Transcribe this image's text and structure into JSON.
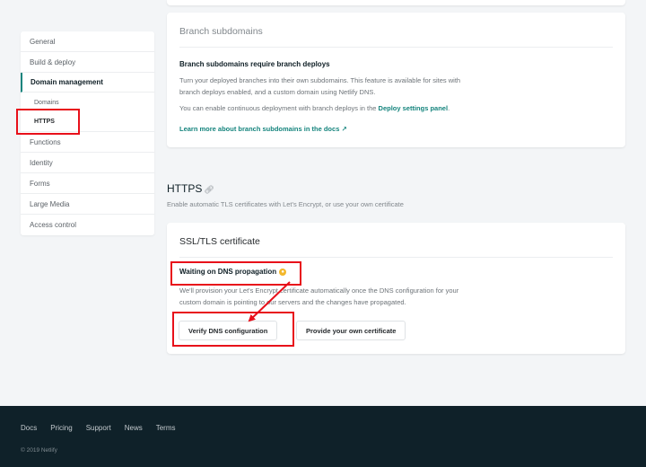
{
  "sidebar": {
    "items": [
      {
        "label": "General"
      },
      {
        "label": "Build & deploy"
      },
      {
        "label": "Domain management"
      },
      {
        "label": "Domains"
      },
      {
        "label": "HTTPS"
      },
      {
        "label": "Functions"
      },
      {
        "label": "Identity"
      },
      {
        "label": "Forms"
      },
      {
        "label": "Large Media"
      },
      {
        "label": "Access control"
      }
    ]
  },
  "branch_card": {
    "title": "Branch subdomains",
    "subtitle": "Branch subdomains require branch deploys",
    "line1": "Turn your deployed branches into their own subdomains. This feature is available for sites with",
    "line2": "branch deploys enabled, and a custom domain using Netlify DNS.",
    "line3_prefix": "You can enable continuous deployment with branch deploys in the ",
    "line3_link": "Deploy settings panel",
    "line3_suffix": ".",
    "learn_link": "Learn more about branch subdomains in the docs ↗"
  },
  "https_section": {
    "title": "HTTPS",
    "anchor_icon": "link-icon",
    "description": "Enable automatic TLS certificates with Let's Encrypt, or use your own certificate"
  },
  "ssl_card": {
    "title": "SSL/TLS certificate",
    "status": "Waiting on DNS propagation",
    "status_icon": "pending-icon",
    "status_color": "#f3b72b",
    "text1": "We'll provision your Let's Encrypt certificate automatically once the DNS configuration for your",
    "text2": "custom domain is pointing to our servers and the changes have propagated.",
    "verify_button": "Verify DNS configuration",
    "own_cert_button": "Provide your own certificate"
  },
  "footer": {
    "links": [
      "Docs",
      "Pricing",
      "Support",
      "News",
      "Terms"
    ],
    "copyright": "© 2019 Netlify"
  },
  "colors": {
    "accent": "#15847d",
    "annotation": "#e8101a",
    "footer_bg": "#0f2129"
  }
}
